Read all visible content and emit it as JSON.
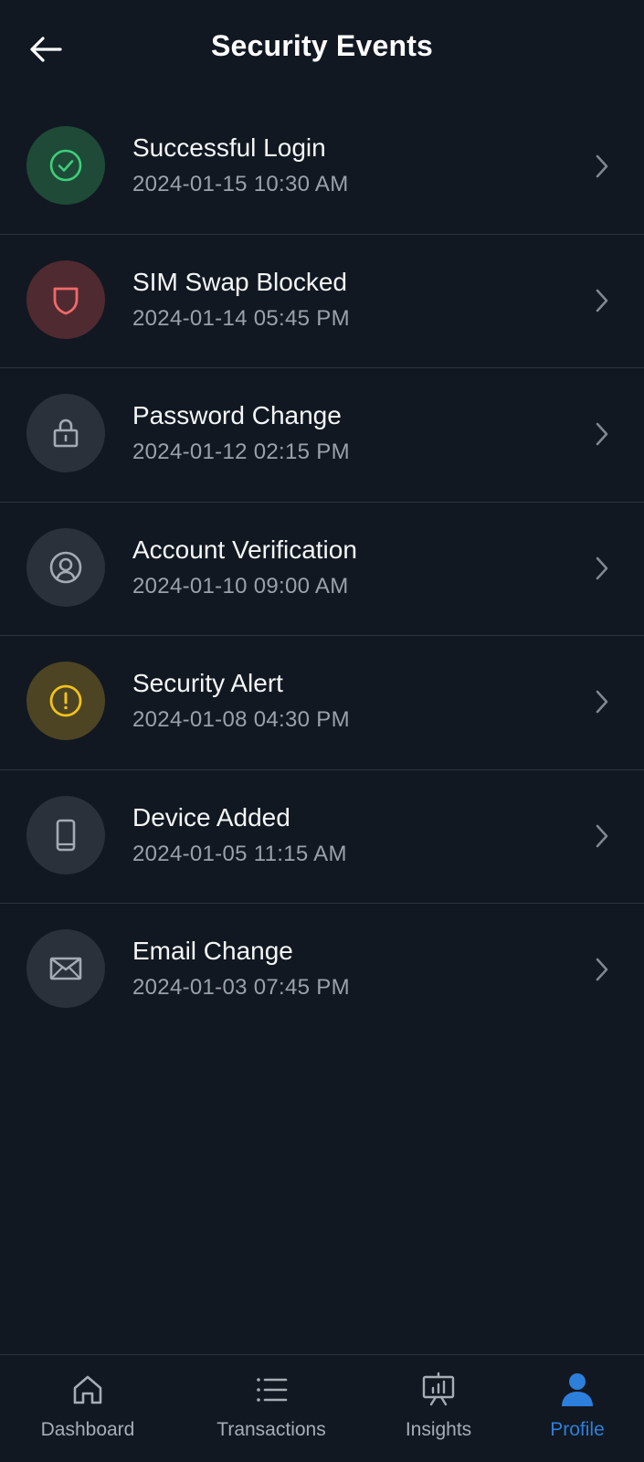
{
  "header": {
    "title": "Security Events",
    "back_icon": "arrow-left-icon"
  },
  "events": [
    {
      "title": "Successful Login",
      "time": "2024-01-15 10:30 AM",
      "icon": "check-circle-icon",
      "circle_color": "#1e4a37",
      "icon_color": "#3ecf7a"
    },
    {
      "title": "SIM Swap Blocked",
      "time": "2024-01-14 05:45 PM",
      "icon": "shield-icon",
      "circle_color": "#4f2a30",
      "icon_color": "#f06a6a"
    },
    {
      "title": "Password Change",
      "time": "2024-01-12 02:15 PM",
      "icon": "lock-icon",
      "circle_color": "#2a313b",
      "icon_color": "#a4abb4"
    },
    {
      "title": "Account Verification",
      "time": "2024-01-10 09:00 AM",
      "icon": "user-circle-icon",
      "circle_color": "#2a313b",
      "icon_color": "#a4abb4"
    },
    {
      "title": "Security Alert",
      "time": "2024-01-08 04:30 PM",
      "icon": "alert-circle-icon",
      "circle_color": "#4d4424",
      "icon_color": "#f2c218"
    },
    {
      "title": "Device Added",
      "time": "2024-01-05 11:15 AM",
      "icon": "smartphone-icon",
      "circle_color": "#2a313b",
      "icon_color": "#a4abb4"
    },
    {
      "title": "Email Change",
      "time": "2024-01-03 07:45 PM",
      "icon": "mail-icon",
      "circle_color": "#2a313b",
      "icon_color": "#a4abb4"
    }
  ],
  "nav": {
    "items": [
      {
        "label": "Dashboard",
        "icon": "home-icon",
        "active": false
      },
      {
        "label": "Transactions",
        "icon": "list-icon",
        "active": false
      },
      {
        "label": "Insights",
        "icon": "presentation-chart-icon",
        "active": false
      },
      {
        "label": "Profile",
        "icon": "user-icon",
        "active": true
      }
    ],
    "active_color": "#2d7fdc",
    "inactive_color": "#a7adb5"
  }
}
